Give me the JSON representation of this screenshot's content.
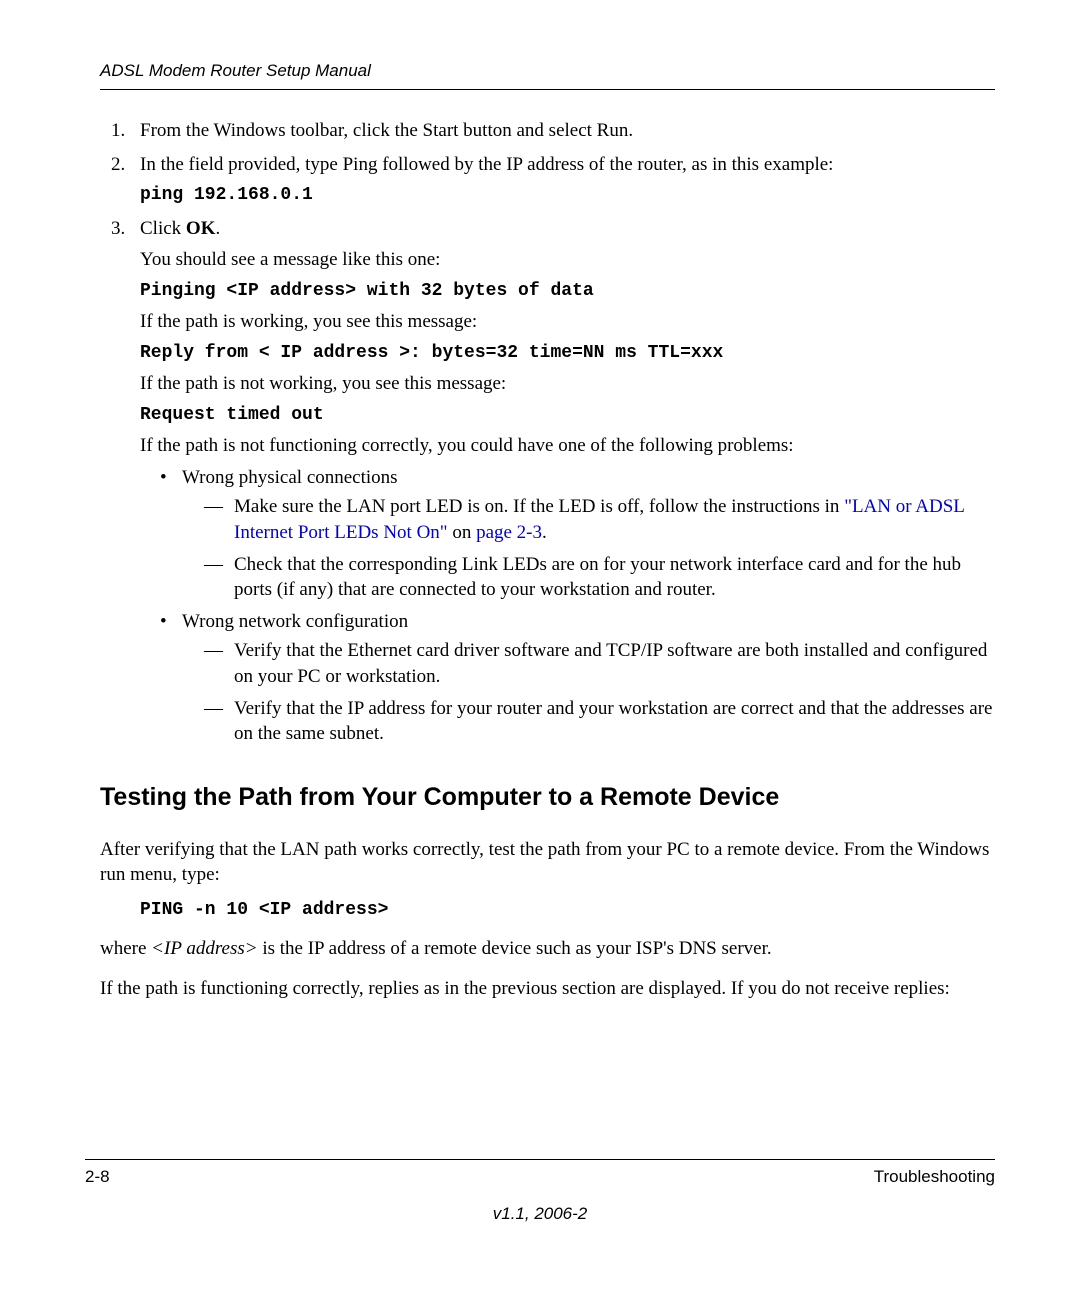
{
  "header": {
    "title": "ADSL Modem Router Setup Manual"
  },
  "list": {
    "item1": "From the Windows toolbar, click the Start button and select Run.",
    "item2": "In the field provided, type Ping followed by the IP address of the router, as in this example:",
    "item2_code": "ping 192.168.0.1",
    "item3_prefix": "Click ",
    "item3_bold": "OK",
    "item3_suffix": ".",
    "you_should": "You should see a message like this one:",
    "pinging": "Pinging <IP address> with 32 bytes of data",
    "path_working": "If the path is working, you see this message:",
    "reply": "Reply from < IP address >: bytes=32 time=NN ms TTL=xxx",
    "path_not_working": "If the path is not working, you see this message:",
    "timeout": "Request timed out",
    "not_functioning": "If the path is not functioning correctly, you could have one of the following problems:",
    "wrong_physical": "Wrong physical connections",
    "dash1_prefix": "Make sure the LAN port LED is on. If the LED is off, follow the instructions in ",
    "dash1_link": "\"LAN or ADSL Internet Port LEDs Not On\"",
    "dash1_mid": " on ",
    "dash1_page": "page 2-3",
    "dash1_suffix": ".",
    "dash2": "Check that the corresponding Link LEDs are on for your network interface card and for the hub ports (if any) that are connected to your workstation and router.",
    "wrong_network": "Wrong network configuration",
    "dash3": "Verify that the Ethernet card driver software and TCP/IP software are both installed and configured on your PC or workstation.",
    "dash4": "Verify that the IP address for your router and your workstation are correct and that the addresses are on the same subnet."
  },
  "section": {
    "heading": "Testing the Path from Your Computer to a Remote Device",
    "para1": "After verifying that the LAN path works correctly, test the path from your PC to a remote device. From the Windows run menu, type:",
    "code": "PING -n 10 <IP address>",
    "para2_prefix": "where ",
    "para2_italic": "<IP address>",
    "para2_suffix": " is the IP address of a remote device such as your ISP's DNS server.",
    "para3": "If the path is functioning correctly, replies as in the previous section are displayed. If you do not receive replies:"
  },
  "footer": {
    "page": "2-8",
    "section": "Troubleshooting",
    "version": "v1.1, 2006-2"
  }
}
